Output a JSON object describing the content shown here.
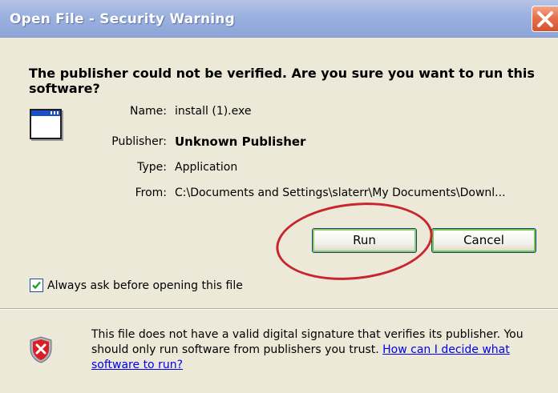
{
  "window": {
    "title": "Open File - Security Warning",
    "close_icon": "close-x-icon",
    "close_color": "#e8704d"
  },
  "headline": "The publisher could not be verified.  Are you sure you want to run this software?",
  "details": {
    "app_icon": "application-window-icon",
    "name_label": "Name:",
    "name_value": "install (1).exe",
    "publisher_label": "Publisher:",
    "publisher_value": "Unknown Publisher",
    "type_label": "Type:",
    "type_value": "Application",
    "from_label": "From:",
    "from_value": "C:\\Documents and Settings\\slaterr\\My Documents\\Downl..."
  },
  "buttons": {
    "run_label": "Run",
    "cancel_label": "Cancel"
  },
  "annotation": {
    "highlight_color": "#c8262e"
  },
  "checkbox": {
    "label": "Always ask before opening this file",
    "checked": true
  },
  "warning": {
    "icon": "shield-error-icon",
    "text": "This file does not have a valid digital signature that verifies its publisher. You should only run software from publishers you trust.  ",
    "link": "How can I decide what software to run?"
  }
}
